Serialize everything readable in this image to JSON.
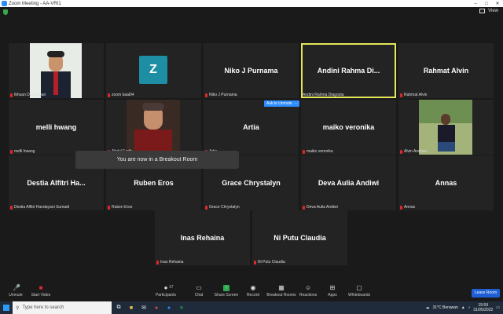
{
  "window": {
    "title": "Zoom Meeting - AA-VRI1"
  },
  "top_right": {
    "view_label": "View"
  },
  "tiles": [
    {
      "name": "",
      "label": "Ikhsan Darmawan"
    },
    {
      "name": "",
      "avatar": "Z",
      "label": "zoom baal04"
    },
    {
      "name": "Niko J Purnama",
      "label": "Niko J Purnama"
    },
    {
      "name": "Andini  Rahma  Di...",
      "label": "Andini Rahma Diagosta"
    },
    {
      "name": "Rahmat Alvin",
      "label": "Rahmat Alvin"
    },
    {
      "name": "melli hwang",
      "label": "melli hwang"
    },
    {
      "name": "",
      "label": "Abdul Fadly"
    },
    {
      "name": "Artia",
      "label": "Artia"
    },
    {
      "name": "maiko veronika",
      "label": "maiko veronika"
    },
    {
      "name": "",
      "label": "Alvin Andrian"
    },
    {
      "name": "Destia  Alfitri  Ha...",
      "label": "Destia Alfitri Handayani Sumadi"
    },
    {
      "name": "Ruben Eros",
      "label": "Ruben Eros"
    },
    {
      "name": "Grace Chrystalyn",
      "label": "Grace Chrystalyn"
    },
    {
      "name": "Deva Aulia Andiwi",
      "label": "Deva Aulia Andiwi"
    },
    {
      "name": "Annas",
      "label": "Annas"
    },
    {
      "name": "Inas Rehaina",
      "label": "Inas Rehaina"
    },
    {
      "name": "Ni Putu Claudia",
      "label": "Ni Putu Claudia"
    }
  ],
  "banner": "You are now in a Breakout Room",
  "ask_to_unmute": "Ask to Unmute",
  "ask_more": "...",
  "toolbar": {
    "unmute": "Unmute",
    "start_video": "Start Video",
    "participants": "Participants",
    "participants_count": "17",
    "chat": "Chat",
    "share_screen": "Share Screen",
    "record": "Record",
    "breakout_rooms": "Breakout Rooms",
    "reactions": "Reactions",
    "apps": "Apps",
    "whiteboards": "Whiteboards",
    "leave_room": "Leave Room"
  },
  "taskbar": {
    "search_placeholder": "Type here to search",
    "weather": "31°C  Berawan",
    "time": "15:59",
    "date": "31/05/2022"
  },
  "colors": {
    "active_outline": "#e6e65a",
    "accent": "#2d8cff",
    "mute_red": "#e02828"
  }
}
